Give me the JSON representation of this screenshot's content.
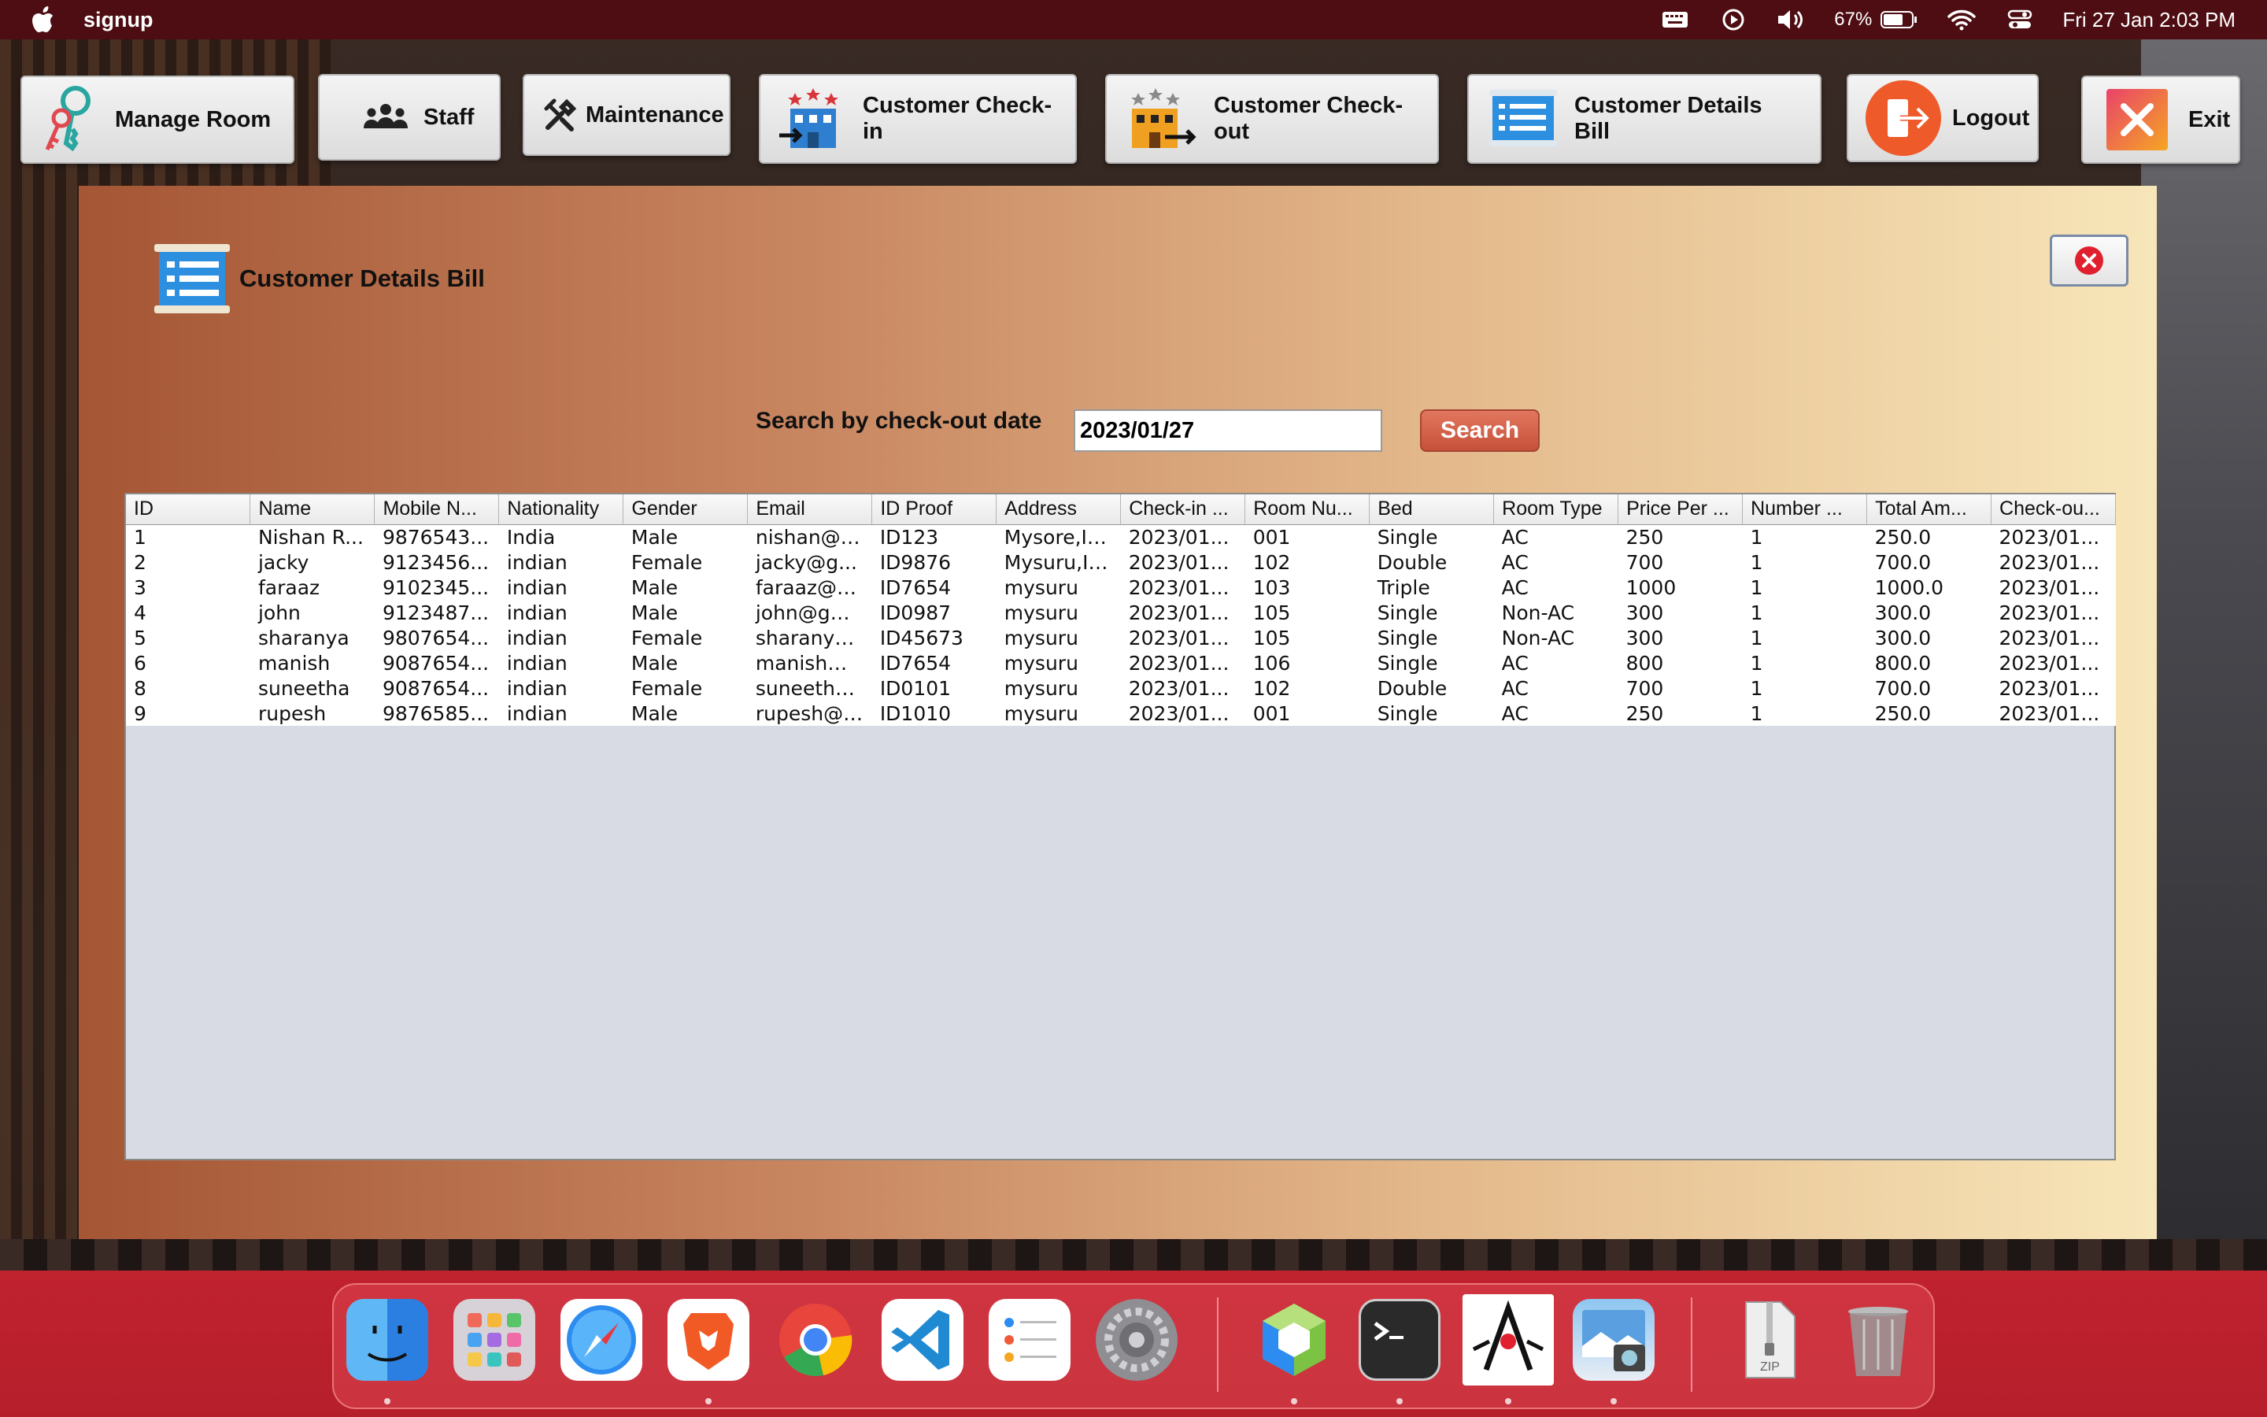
{
  "menubar": {
    "app_name": "signup",
    "battery": "67%",
    "datetime": "Fri 27 Jan  2:03 PM"
  },
  "toolbar": {
    "manage_room": "Manage Room",
    "staff": "Staff",
    "maintenance": "Maintenance",
    "checkin": "Customer Check-in",
    "checkout": "Customer Check-out",
    "details_bill": "Customer Details Bill",
    "logout": "Logout",
    "exit": "Exit"
  },
  "panel": {
    "title": "Customer Details Bill",
    "search_label": "Search by check-out date",
    "search_value": "2023/01/27",
    "search_button": "Search"
  },
  "table": {
    "columns": [
      "ID",
      "Name",
      "Mobile N...",
      "Nationality",
      "Gender",
      "Email",
      "ID Proof",
      "Address",
      "Check-in ...",
      "Room Nu...",
      "Bed",
      "Room Type",
      "Price Per ...",
      "Number ...",
      "Total Am...",
      "Check-ou..."
    ],
    "rows": [
      [
        "1",
        "Nishan R...",
        "9876543...",
        "India",
        "Male",
        "nishan@g...",
        "ID123",
        "Mysore,In...",
        "2023/01...",
        "001",
        "Single",
        "AC",
        "250",
        "1",
        "250.0",
        "2023/01..."
      ],
      [
        "2",
        "jacky",
        "9123456...",
        "indian",
        "Female",
        "jacky@g...",
        "ID9876",
        "Mysuru,In...",
        "2023/01...",
        "102",
        "Double",
        "AC",
        "700",
        "1",
        "700.0",
        "2023/01..."
      ],
      [
        "3",
        "faraaz",
        "9102345...",
        "indian",
        "Male",
        "faraaz@g...",
        "ID7654",
        "mysuru",
        "2023/01...",
        "103",
        "Triple",
        "AC",
        "1000",
        "1",
        "1000.0",
        "2023/01..."
      ],
      [
        "4",
        "john",
        "9123487...",
        "indian",
        "Male",
        "john@gm...",
        "ID0987",
        "mysuru",
        "2023/01...",
        "105",
        "Single",
        "Non-AC",
        "300",
        "1",
        "300.0",
        "2023/01..."
      ],
      [
        "5",
        "sharanya",
        "9807654...",
        "indian",
        "Female",
        "sharanya...",
        "ID45673",
        "mysuru",
        "2023/01...",
        "105",
        "Single",
        "Non-AC",
        "300",
        "1",
        "300.0",
        "2023/01..."
      ],
      [
        "6",
        "manish",
        "9087654...",
        "indian",
        "Male",
        "manish@...",
        "ID7654",
        "mysuru",
        "2023/01...",
        "106",
        "Single",
        "AC",
        "800",
        "1",
        "800.0",
        "2023/01..."
      ],
      [
        "8",
        "suneetha",
        "9087654...",
        "indian",
        "Female",
        "suneetha...",
        "ID0101",
        "mysuru",
        "2023/01...",
        "102",
        "Double",
        "AC",
        "700",
        "1",
        "700.0",
        "2023/01..."
      ],
      [
        "9",
        "rupesh",
        "9876585...",
        "indian",
        "Male",
        "rupesh@g...",
        "ID1010",
        "mysuru",
        "2023/01...",
        "001",
        "Single",
        "AC",
        "250",
        "1",
        "250.0",
        "2023/01..."
      ]
    ]
  },
  "dock": {
    "items": [
      "finder-icon",
      "launchpad-icon",
      "safari-icon",
      "brave-icon",
      "chrome-icon",
      "vscode-icon",
      "reminders-icon",
      "system-settings-icon",
      "netbeans-icon",
      "terminal-icon",
      "java-icon",
      "preview-icon",
      "zip-archive-icon",
      "trash-icon"
    ],
    "zip_label": "ZIP"
  },
  "colors": {
    "menubar": "#4d0d12",
    "dock": "#c0222e",
    "search_button": "#d0583f"
  }
}
